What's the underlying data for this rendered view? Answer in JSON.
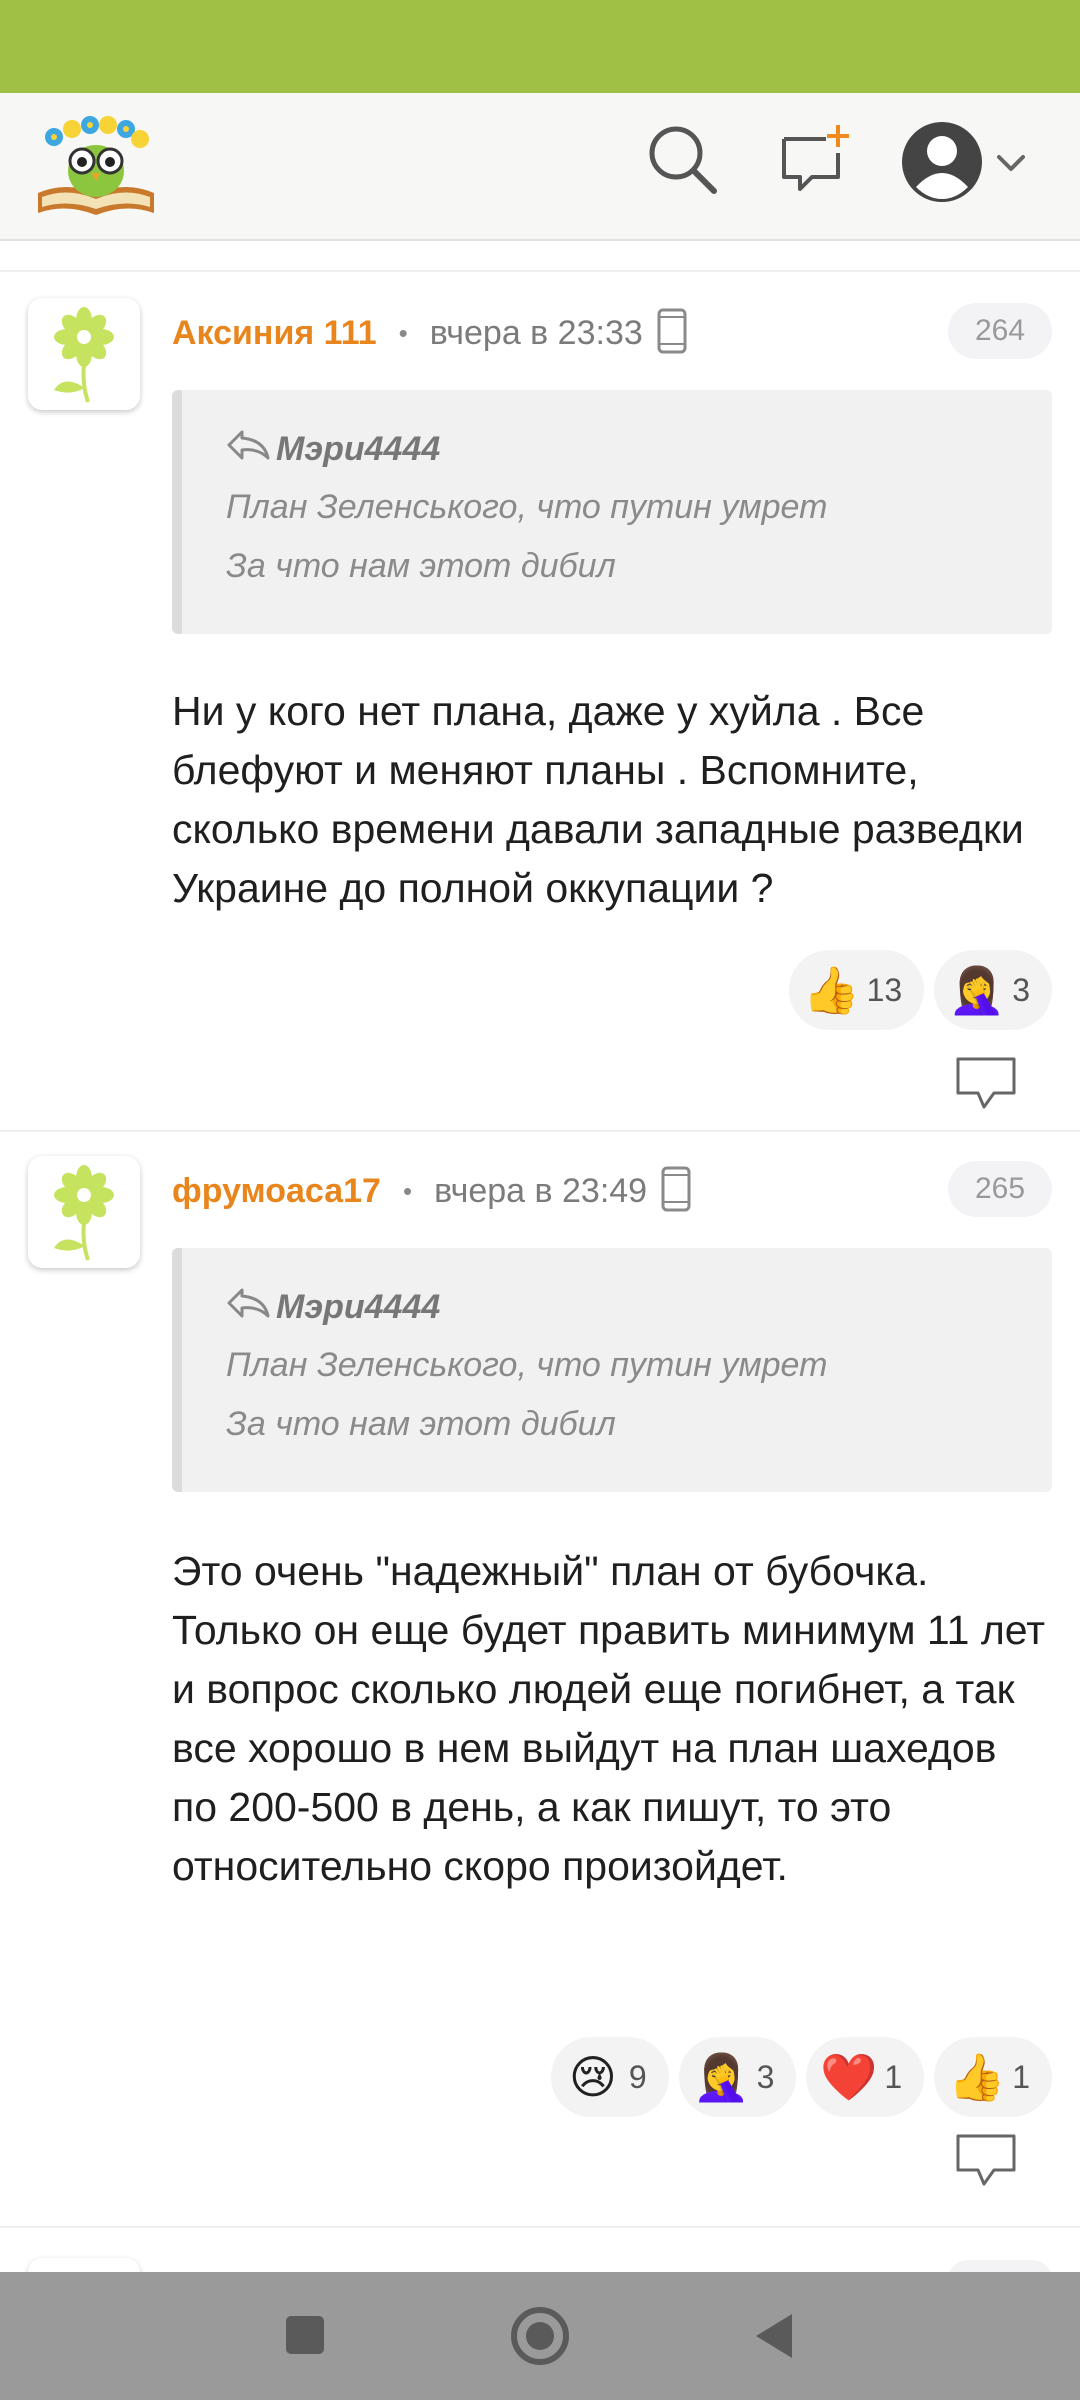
{
  "header": {
    "logo": "owl-on-book-logo",
    "icons": [
      "search-icon",
      "new-topic-icon",
      "user-avatar-icon",
      "chevron-down-icon"
    ]
  },
  "comments": [
    {
      "author": "Аксиния 111",
      "separator": "•",
      "time": "вчера в 23:33",
      "device": "mobile-device-icon",
      "number": "264",
      "quote": {
        "author": "Мэри4444",
        "lines": [
          "План Зеленського, что путин умрет",
          "За что нам этот дибил"
        ]
      },
      "body": "Ни у кого нет плана, даже у хуйла . Все блефуют и меняют планы . Вспомните, сколько времени давали западные разведки Украине до полной оккупации ?",
      "reactions": [
        {
          "emoji": "👍",
          "count": "13"
        },
        {
          "emoji": "🤦‍♀️",
          "count": "3"
        }
      ]
    },
    {
      "author": "фрумоаса17",
      "separator": "•",
      "time": "вчера в 23:49",
      "device": "mobile-device-icon",
      "number": "265",
      "quote": {
        "author": "Мэри4444",
        "lines": [
          "План Зеленського, что путин умрет",
          "За что нам этот дибил"
        ]
      },
      "body": "Это очень \"надежный\" план от бубочка. Только он еще будет править минимум 11 лет и вопрос сколько людей еще погибнет, а так все хорошо в нем выйдут на план шахедов по 200-500 в день, а как пишут, то это относительно скоро произойдет.",
      "reactions": [
        {
          "emoji": "😢",
          "count": "9"
        },
        {
          "emoji": "🤦‍♀️",
          "count": "3"
        },
        {
          "emoji": "❤️",
          "count": "1"
        },
        {
          "emoji": "👍",
          "count": "1"
        }
      ]
    }
  ],
  "colors": {
    "status_bar": "#9fc045",
    "author": "#e8861d",
    "nav_bar": "#9a9a9a"
  },
  "nav": [
    "recent-apps-icon",
    "home-icon",
    "back-icon"
  ]
}
